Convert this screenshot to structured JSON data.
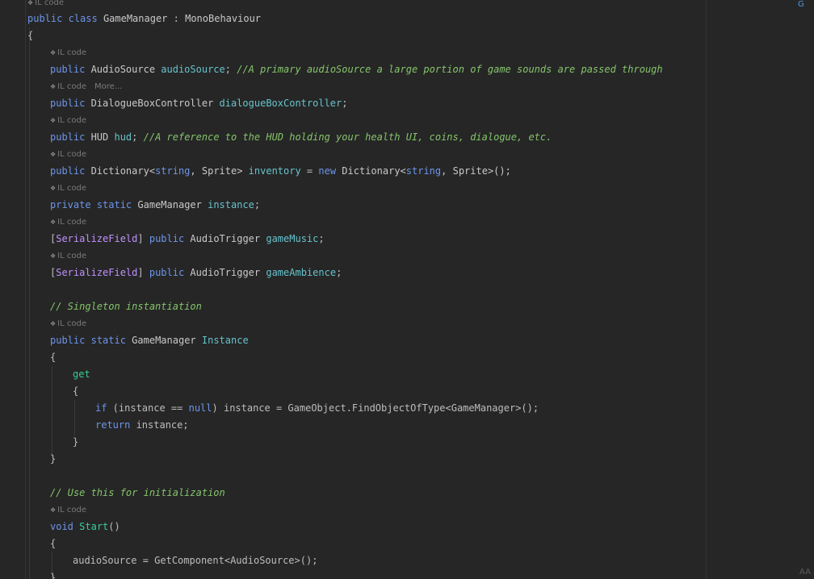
{
  "hints": {
    "il_code": "IL code",
    "more": "More..."
  },
  "code": {
    "l_class": [
      "public",
      " class ",
      "GameManager",
      " : ",
      "MonoBehaviour"
    ],
    "open_brace": "{",
    "close_brace": "}",
    "l_audio": [
      "public",
      " AudioSource ",
      "audioSource",
      "; ",
      "//A primary audioSource a large portion of game sounds are passed through"
    ],
    "l_dialogue": [
      "public",
      " DialogueBoxController ",
      "dialogueBoxController",
      ";"
    ],
    "l_hud": [
      "public",
      " HUD ",
      "hud",
      "; ",
      "//A reference to the HUD holding your health UI, coins, dialogue, etc."
    ],
    "l_inventory": [
      "public",
      " Dictionary<",
      "string",
      ", Sprite> ",
      "inventory",
      " = ",
      "new",
      " Dictionary<",
      "string",
      ", Sprite>();"
    ],
    "l_instance": [
      "private",
      " ",
      "static",
      " GameManager ",
      "instance",
      ";"
    ],
    "l_music": [
      "[",
      "SerializeField",
      "] ",
      "public",
      " AudioTrigger ",
      "gameMusic",
      ";"
    ],
    "l_ambience": [
      "[",
      "SerializeField",
      "] ",
      "public",
      " AudioTrigger ",
      "gameAmbience",
      ";"
    ],
    "l_singleton_comment": "// Singleton instantiation",
    "l_instance_prop": [
      "public",
      " ",
      "static",
      " GameManager ",
      "Instance"
    ],
    "l_get": "get",
    "l_if": [
      "if",
      " (instance == ",
      "null",
      ") instance = GameObject.FindObjectOfType<GameManager>();"
    ],
    "l_return": [
      "return",
      " instance;"
    ],
    "l_init_comment": "// Use this for initialization",
    "l_start": [
      "void",
      " ",
      "Start",
      "()"
    ],
    "l_getcomp": "audioSource = GetComponent<AudioSource>();"
  },
  "corner": {
    "tab_marker": "G",
    "font_size_label": "AA"
  },
  "colors": {
    "background": "#262626",
    "keyword": "#6c95eb",
    "field": "#66c3cc",
    "comment": "#85c46c",
    "attribute": "#c191ff",
    "text": "#bdbdbd"
  }
}
